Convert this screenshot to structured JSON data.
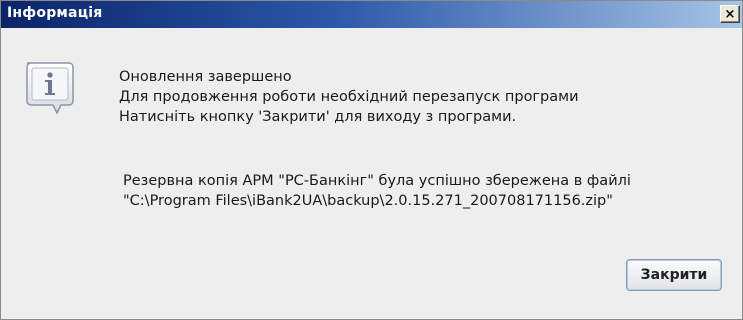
{
  "window": {
    "title": "Інформація",
    "close_glyph": "×"
  },
  "message": {
    "icon": "info-icon",
    "lines": [
      "Оновлення завершено",
      "Для продовження роботи необхідний перезапуск програми",
      "Натисніть кнопку 'Закрити' для виходу з програми."
    ],
    "backup_lines": [
      "Резервна копія АРМ \"PC-Банкінг\" була успішно збережена в файлі",
      "\"C:\\Program Files\\iBank2UA\\backup\\2.0.15.271_200708171156.zip\""
    ]
  },
  "buttons": {
    "close_label": "Закрити"
  },
  "colors": {
    "titlebar_start": "#0a246a",
    "titlebar_end": "#a6c4e6",
    "background": "#eeeeee"
  }
}
